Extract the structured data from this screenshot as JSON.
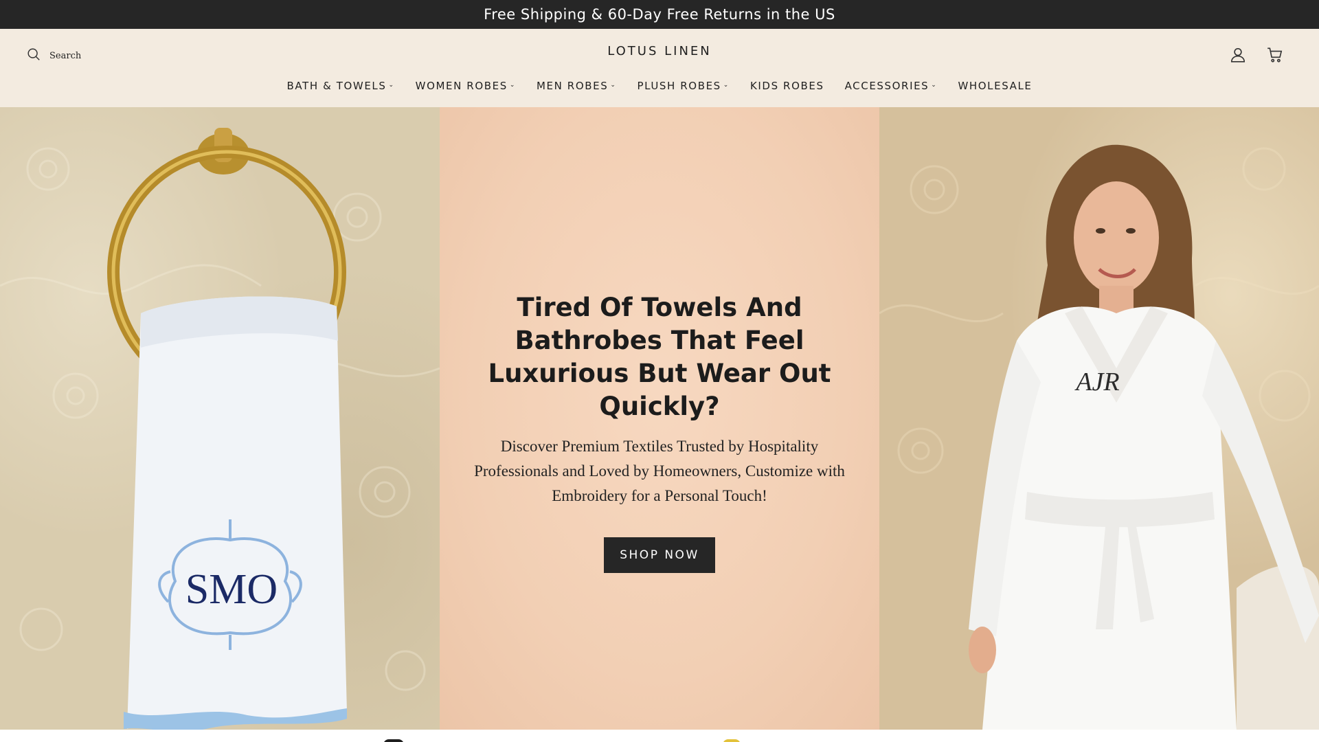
{
  "announcement": {
    "text": "Free Shipping & 60-Day Free Returns in the US"
  },
  "header": {
    "search_label": "Search",
    "logo": "LOTUS LINEN",
    "icons": [
      "account-icon",
      "cart-icon"
    ]
  },
  "nav": {
    "items": [
      {
        "label": "BATH & TOWELS",
        "has_dropdown": true
      },
      {
        "label": "WOMEN ROBES",
        "has_dropdown": true
      },
      {
        "label": "MEN ROBES",
        "has_dropdown": true
      },
      {
        "label": "PLUSH ROBES",
        "has_dropdown": true
      },
      {
        "label": "KIDS ROBES",
        "has_dropdown": false
      },
      {
        "label": "ACCESSORIES",
        "has_dropdown": true
      },
      {
        "label": "WHOLESALE",
        "has_dropdown": false
      }
    ],
    "chevron": "⌄"
  },
  "hero": {
    "title": "Tired Of Towels And Bathrobes That Feel Luxurious But Wear Out Quickly?",
    "subtitle": "Discover Premium Textiles Trusted by Hospitality Professionals and Loved by Homeowners, Customize with Embroidery for a Personal Touch!",
    "cta_label": "SHOP NOW",
    "towel_monogram": "SMO",
    "robe_monogram": "AJR"
  },
  "colors": {
    "announcement_bg": "#262626",
    "header_bg": "#f3ebe0",
    "center_panel_bg": "#f2cfb4",
    "cta_bg": "#262626"
  }
}
